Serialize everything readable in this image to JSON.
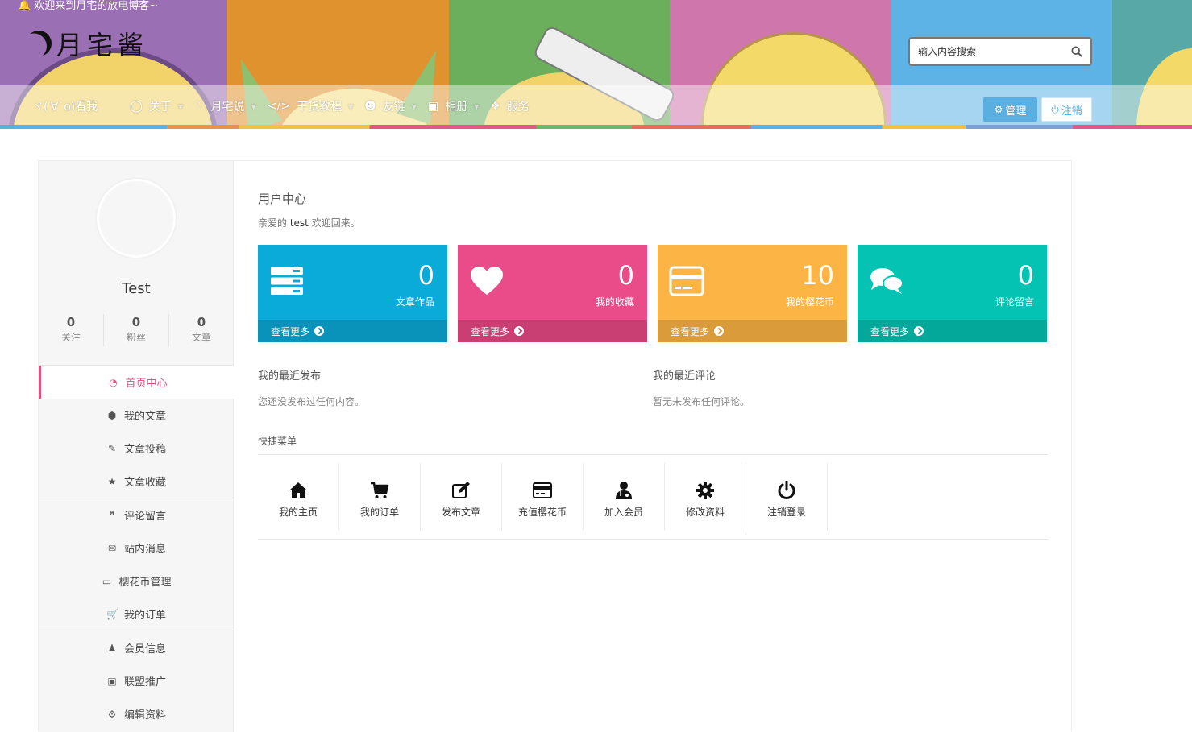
{
  "header": {
    "welcome": "欢迎来到月宅的放电博客~",
    "logo_text": "月宅酱",
    "search_placeholder": "输入内容搜索",
    "nav": [
      {
        "label": "ヾ(′∀`o)看我",
        "icon": "",
        "caret": false
      },
      {
        "label": "关于",
        "icon": "circle-icon",
        "caret": true
      },
      {
        "label": "月宅说",
        "icon": "heart-icon",
        "caret": true
      },
      {
        "label": "干货教程",
        "icon": "code-icon",
        "caret": true
      },
      {
        "label": "友链",
        "icon": "users-icon",
        "caret": true
      },
      {
        "label": "相册",
        "icon": "image-icon",
        "caret": true
      },
      {
        "label": "服务",
        "icon": "cubes-icon",
        "caret": false
      }
    ],
    "manage_label": "管理",
    "logout_label": "注销"
  },
  "user": {
    "name": "Test",
    "stats": [
      {
        "num": "0",
        "label": "关注"
      },
      {
        "num": "0",
        "label": "粉丝"
      },
      {
        "num": "0",
        "label": "文章"
      }
    ]
  },
  "menu": [
    [
      {
        "label": "首页中心",
        "icon": "dashboard-icon",
        "active": true
      },
      {
        "label": "我的文章",
        "icon": "cube-icon"
      },
      {
        "label": "文章投稿",
        "icon": "edit-icon"
      },
      {
        "label": "文章收藏",
        "icon": "star-icon"
      }
    ],
    [
      {
        "label": "评论留言",
        "icon": "comments-icon"
      },
      {
        "label": "站内消息",
        "icon": "envelope-icon"
      },
      {
        "label": "樱花币管理",
        "icon": "credit-card-icon"
      },
      {
        "label": "我的订单",
        "icon": "cart-icon"
      }
    ],
    [
      {
        "label": "会员信息",
        "icon": "user-md-icon"
      },
      {
        "label": "联盟推广",
        "icon": "money-icon"
      },
      {
        "label": "编辑资料",
        "icon": "gear-icon"
      }
    ]
  ],
  "main": {
    "title": "用户中心",
    "greet_prefix": "亲爱的",
    "greet_user": "test",
    "greet_suffix": "欢迎回来。",
    "cards": [
      {
        "num": "0",
        "label": "文章作品",
        "more": "查看更多",
        "icon": "server-icon",
        "color": "#0aabd8"
      },
      {
        "num": "0",
        "label": "我的收藏",
        "more": "查看更多",
        "icon": "heart-icon",
        "color": "#e94c89"
      },
      {
        "num": "10",
        "label": "我的樱花币",
        "more": "查看更多",
        "icon": "credit-card-icon",
        "color": "#fcb445"
      },
      {
        "num": "0",
        "label": "评论留言",
        "more": "查看更多",
        "icon": "comments-icon",
        "color": "#05c3b3"
      }
    ],
    "recent_posts_title": "我的最近发布",
    "recent_posts_text": "您还没发布过任何内容。",
    "recent_comments_title": "我的最近评论",
    "recent_comments_text": "暂无未发布任何评论。",
    "quick_title": "快捷菜单",
    "quick": [
      {
        "label": "我的主页",
        "icon": "home-icon"
      },
      {
        "label": "我的订单",
        "icon": "cart-icon"
      },
      {
        "label": "发布文章",
        "icon": "edit-icon"
      },
      {
        "label": "充值樱花币",
        "icon": "credit-card-icon"
      },
      {
        "label": "加入会员",
        "icon": "user-md-icon"
      },
      {
        "label": "修改资料",
        "icon": "gear-icon"
      },
      {
        "label": "注销登录",
        "icon": "power-icon"
      }
    ]
  },
  "colors": {
    "accent": "#d9537f",
    "primary": "#5aaee0"
  }
}
